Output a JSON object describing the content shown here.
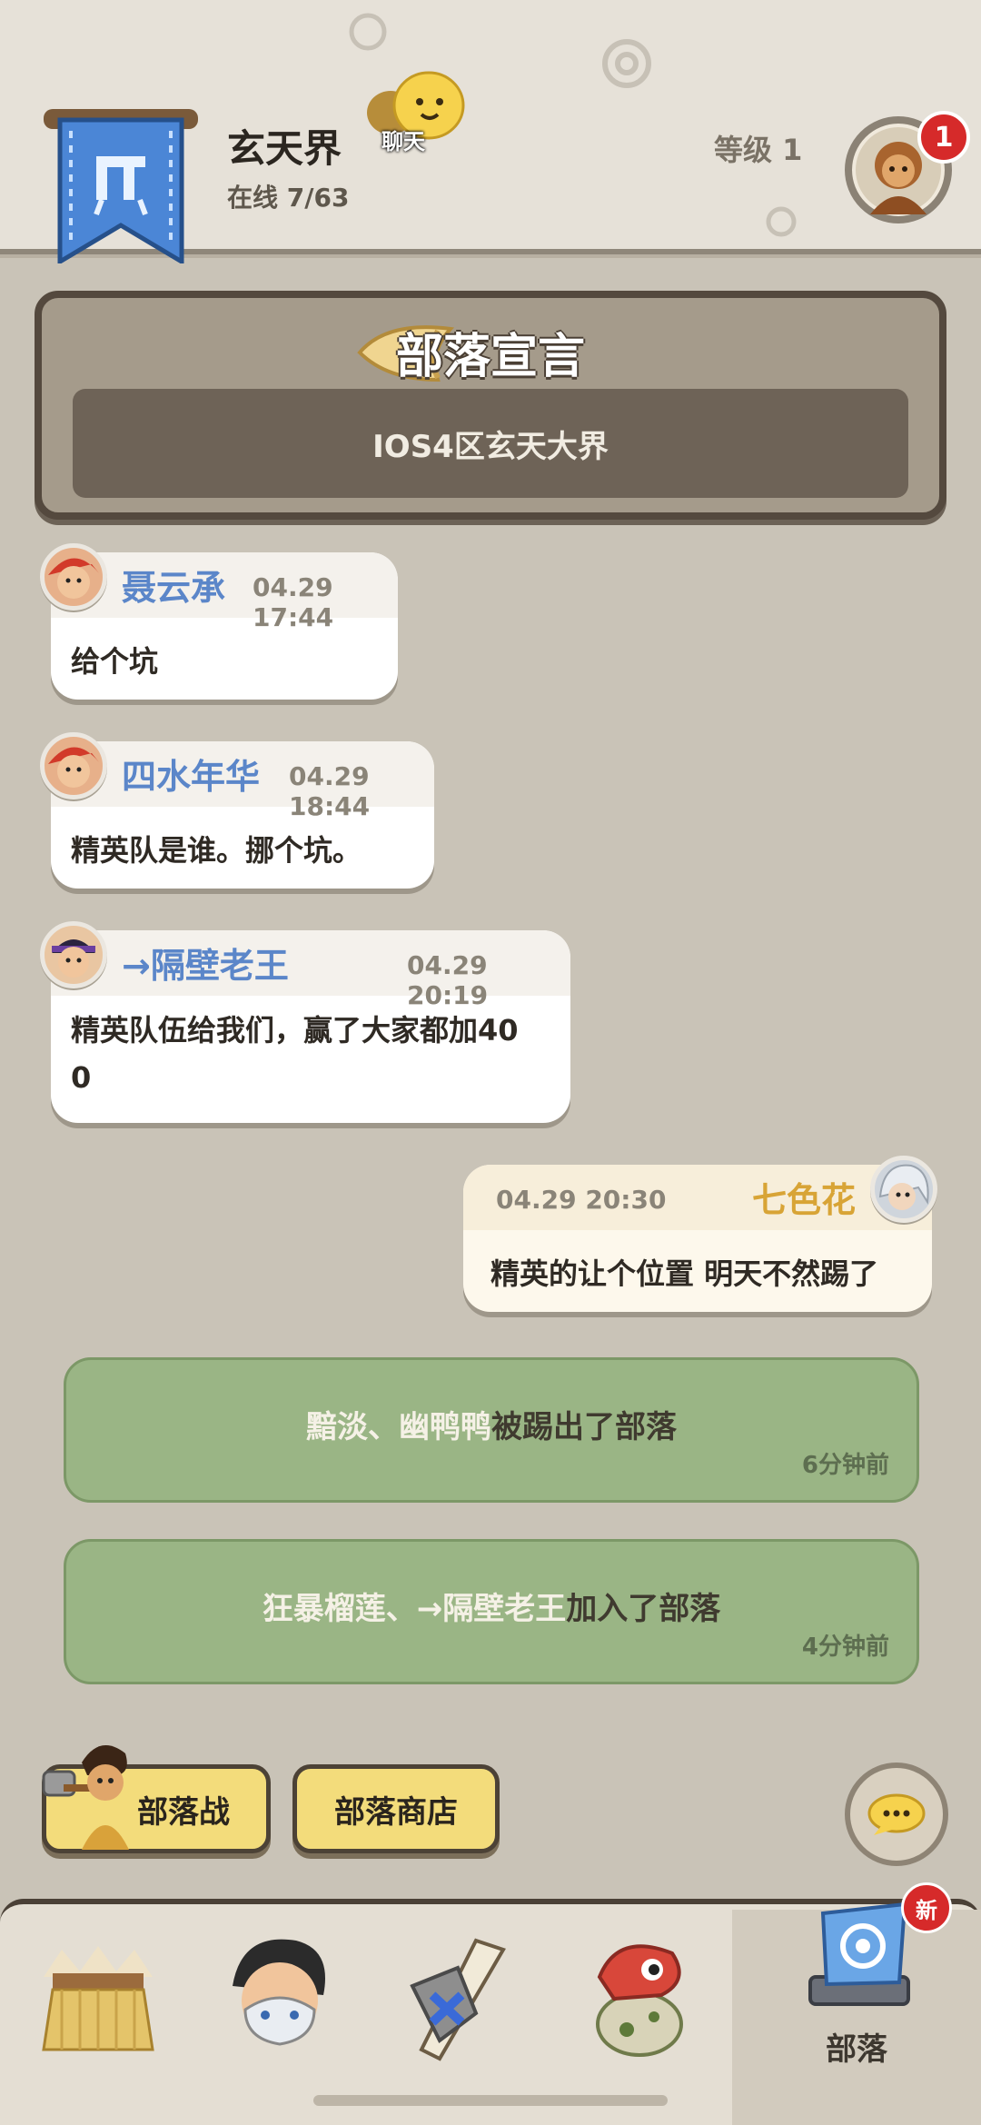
{
  "header": {
    "tribe_name": "玄天界",
    "online": "在线 7/63",
    "chat_label": "聊天",
    "level": "等级 1",
    "badge_count": "1"
  },
  "declaration": {
    "title": "部落宣言",
    "text": "IOS4区玄天大界"
  },
  "messages": [
    {
      "sender": "聂云承",
      "time": "04.29 17:44",
      "text": "给个坑"
    },
    {
      "sender": "四水年华",
      "time": "04.29 18:44",
      "text": "精英队是谁。挪个坑。"
    },
    {
      "sender": "→隔壁老王",
      "time": "04.29 20:19",
      "text_line1": "精英队伍给我们，赢了大家都加40",
      "text_line2": "0"
    },
    {
      "sender": "七色花",
      "time": "04.29 20:30",
      "text": "精英的让个位置 明天不然踢了"
    }
  ],
  "system": [
    {
      "names": "黯淡、幽鸭鸭",
      "action": "被踢出了部落",
      "ago": "6分钟前"
    },
    {
      "names": "狂暴榴莲、→隔壁老王",
      "action": "加入了部落",
      "ago": "4分钟前"
    }
  ],
  "buttons": {
    "tribe_war": "部落战",
    "tribe_shop": "部落商店"
  },
  "nav": {
    "active_label": "部落",
    "new_badge": "新"
  },
  "colors": {
    "background": "#c9c3b7",
    "sender_blue": "#5b86c9",
    "self_gold": "#d8a436",
    "system_green": "#9ab585",
    "button_yellow": "#f3dc7b",
    "badge_red": "#d62a2a"
  }
}
